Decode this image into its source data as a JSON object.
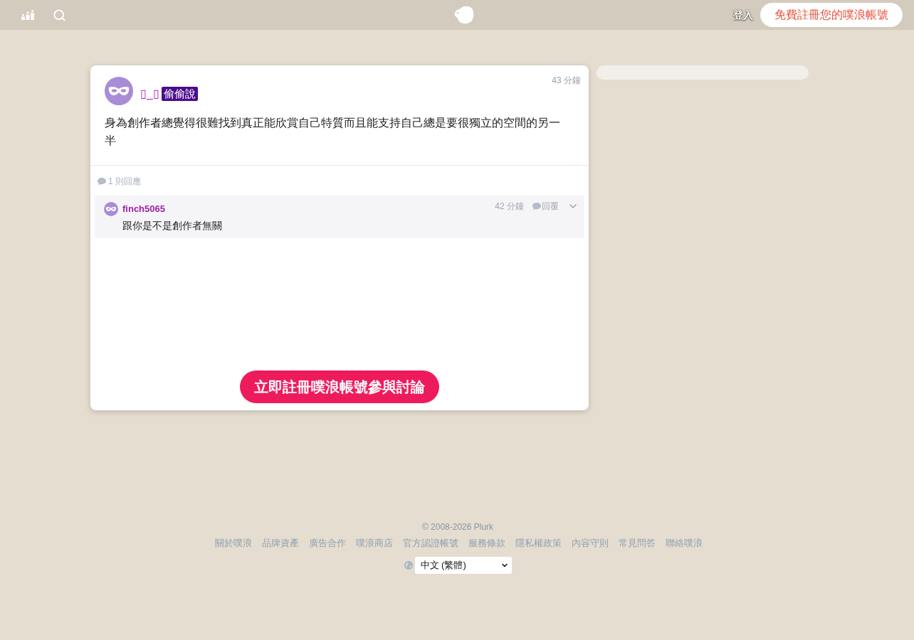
{
  "top_bar": {
    "login_link": "登入",
    "signup_button": "免費註冊您的噗浪帳號"
  },
  "plurk": {
    "author": "▯_▯",
    "badge": "偷偷說",
    "time": "43 分鐘",
    "content": "身為創作者總覺得很難找到真正能欣賞自己特質而且能支持自己總是要很獨立的空間的另一半",
    "response_count": "1 則回應",
    "responses": [
      {
        "author": "finch5065",
        "time": "42 分鐘",
        "reply_label": "回覆",
        "content": "跟你是不是創作者無關"
      }
    ],
    "cta_button": "立即註冊噗浪帳號參與討論"
  },
  "footer": {
    "copyright": "© 2008-2026 Plurk",
    "links": [
      "關於噗浪",
      "品牌資產",
      "廣告合作",
      "噗浪商店",
      "官方認證帳號",
      "服務條款",
      "隱私權政策",
      "內容守則",
      "常見問答",
      "聯絡噗浪"
    ],
    "language": "中文 (繁體)"
  }
}
